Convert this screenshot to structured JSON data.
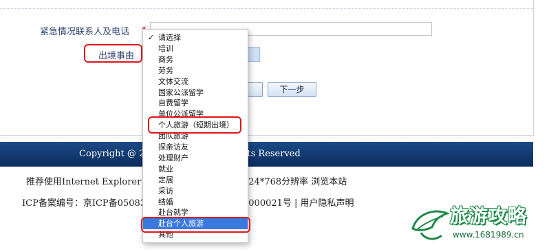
{
  "form": {
    "emergency_contact_label": "紧急情况联系人及电话",
    "emergency_contact_value": "",
    "reason_label": "出境事由",
    "required_mark": "*",
    "next_button": "下一步",
    "prev_button": ""
  },
  "reason_dropdown": {
    "selected_index": 17,
    "checked_index": 0,
    "options": [
      "请选择",
      "培训",
      "商务",
      "劳务",
      "文体交流",
      "国家公派留学",
      "自费留学",
      "单位公派留学",
      "个人旅游（短期出境）",
      "团队旅游",
      "探亲访友",
      "处理财产",
      "就业",
      "定居",
      "采访",
      "结婚",
      "赴台就学",
      "赴台个人旅游",
      "其他"
    ],
    "check_icon": "checkmark-icon"
  },
  "footer": {
    "copyright_left": "Copyright @ 201",
    "copyright_right": "hts Reserved",
    "browser_left": "推荐使用Internet Explorer 6.0",
    "browser_right": "024*768分辨率 浏览本站",
    "icp_left": "ICP备案编号：京ICP备05083(",
    "icp_right": "0000021号 | 用户隐私声明"
  },
  "watermark": {
    "title": "旅游攻略",
    "url": "www.1681989.cn",
    "icon": "leaf-cap-logo-icon"
  },
  "colors": {
    "highlight": "#e0161c",
    "selection": "#3a7ae0",
    "footer_bar": "#0b2c5c",
    "label": "#2a3f6e"
  }
}
